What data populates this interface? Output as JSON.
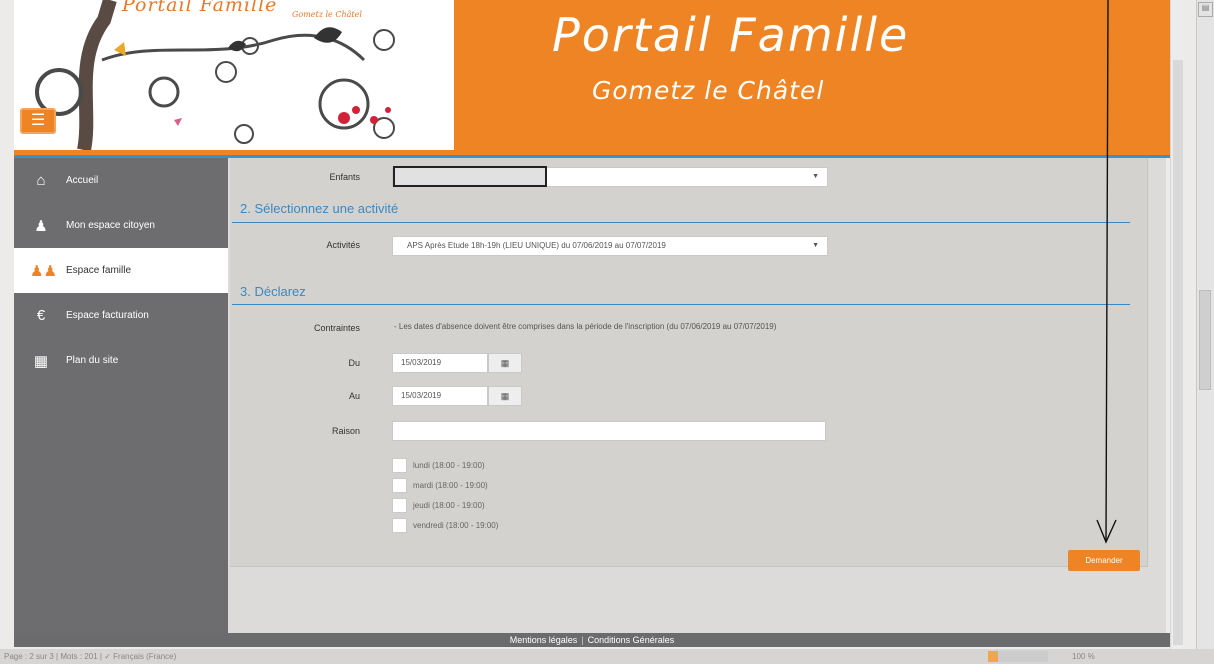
{
  "header": {
    "logo_text": "Portail Famille",
    "logo_subtext": "Gometz le Châtel",
    "title": "Portail Famille",
    "subtitle": "Gometz le Châtel",
    "menu_icon": "hamburger-icon",
    "brand_color": "#ee8424",
    "accent_color": "#3b89c2"
  },
  "sidebar": {
    "items": [
      {
        "label": "Accueil",
        "icon": "home-icon",
        "active": false
      },
      {
        "label": "Mon espace citoyen",
        "icon": "user-icon",
        "active": false
      },
      {
        "label": "Espace famille",
        "icon": "family-icon",
        "active": true
      },
      {
        "label": "Espace facturation",
        "icon": "euro-icon",
        "active": false
      },
      {
        "label": "Plan du site",
        "icon": "sitemap-icon",
        "active": false
      }
    ]
  },
  "form": {
    "enfants_label": "Enfants",
    "section2_title": "2. Sélectionnez une activité",
    "activites_label": "Activités",
    "activite_value": "APS Après Etude 18h-19h (LIEU UNIQUE) du 07/06/2019 au 07/07/2019",
    "section3_title": "3. Déclarez",
    "contraintes_label": "Contraintes",
    "contraintes_text": "- Les dates d'absence doivent être comprises dans la période de l'inscription (du 07/06/2019 au 07/07/2019)",
    "du_label": "Du",
    "du_value": "15/03/2019",
    "au_label": "Au",
    "au_value": "15/03/2019",
    "raison_label": "Raison",
    "raison_value": "",
    "days": [
      {
        "label": "lundi (18:00 - 19:00)",
        "checked": false
      },
      {
        "label": "mardi (18:00 - 19:00)",
        "checked": false
      },
      {
        "label": "jeudi (18:00 - 19:00)",
        "checked": false
      },
      {
        "label": "vendredi (18:00 - 19:00)",
        "checked": false
      }
    ],
    "submit_label": "Demander"
  },
  "footer": {
    "mentions": "Mentions légales",
    "conditions": "Conditions Générales"
  },
  "statusbar": {
    "page": "Page : 2 sur 3",
    "words": "Mots : 201",
    "language": "Français (France)",
    "zoom": "100 %"
  }
}
